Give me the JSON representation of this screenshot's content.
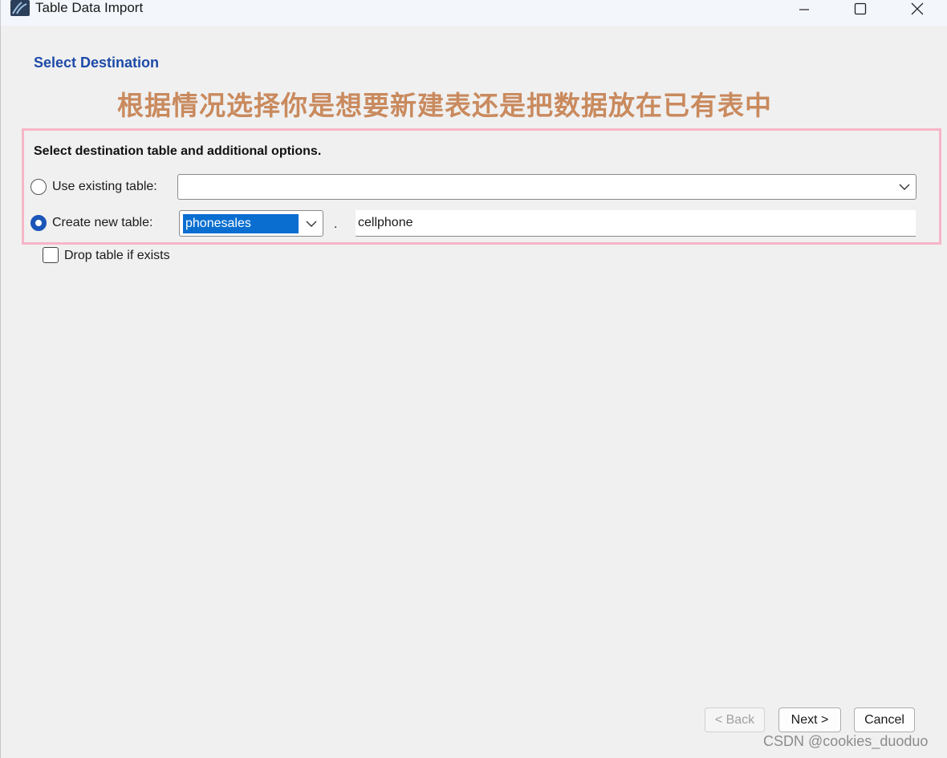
{
  "window": {
    "title": "Table Data Import",
    "icon": "mysql-workbench-icon"
  },
  "page": {
    "section_title": "Select Destination",
    "annotation": "根据情况选择你是想要新建表还是把数据放在已有表中"
  },
  "options": {
    "title": "Select destination table and additional options.",
    "use_existing_label": "Use existing table:",
    "use_existing_value": "",
    "use_existing_selected": false,
    "create_new_label": "Create new table:",
    "create_new_selected": true,
    "schema_value": "phonesales",
    "separator": ".",
    "table_name_value": "cellphone",
    "drop_if_exists_label": "Drop table if exists",
    "drop_if_exists_checked": false
  },
  "footer": {
    "back_label": "< Back",
    "next_label": "Next >",
    "cancel_label": "Cancel"
  },
  "watermark": "CSDN @cookies_duoduo",
  "colors": {
    "section_title": "#1d4aa8",
    "annotation": "#c98a5e",
    "highlight_border": "#f7b5c8",
    "selection": "#0a6ed1"
  }
}
